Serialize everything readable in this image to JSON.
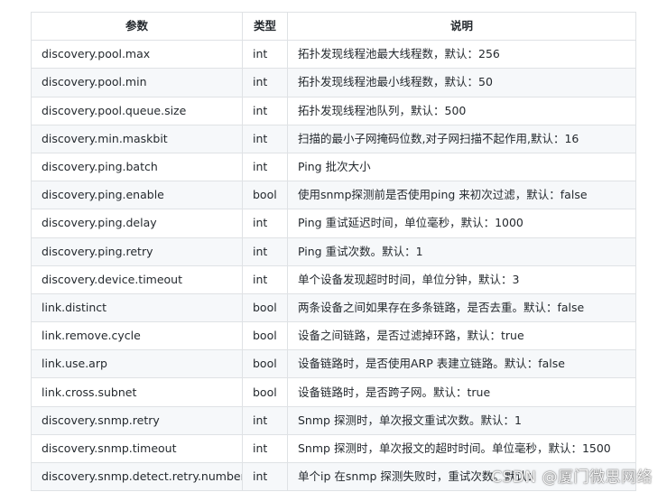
{
  "table": {
    "headers": [
      "参数",
      "类型",
      "说明"
    ],
    "rows": [
      [
        "discovery.pool.max",
        "int",
        "拓扑发现线程池最大线程数，默认：256"
      ],
      [
        "discovery.pool.min",
        "int",
        "拓扑发现线程池最小线程数，默认：50"
      ],
      [
        "discovery.pool.queue.size",
        "int",
        "拓扑发现线程池队列，默认：500"
      ],
      [
        "discovery.min.maskbit",
        "int",
        "扫描的最小子网掩码位数,对子网扫描不起作用,默认：16"
      ],
      [
        "discovery.ping.batch",
        "int",
        "Ping 批次大小"
      ],
      [
        "discovery.ping.enable",
        "bool",
        "使用snmp探测前是否使用ping 来初次过滤，默认：false"
      ],
      [
        "discovery.ping.delay",
        "int",
        "Ping 重试延迟时间，单位毫秒，默认：1000"
      ],
      [
        "discovery.ping.retry",
        "int",
        "Ping 重试次数。默认：1"
      ],
      [
        "discovery.device.timeout",
        "int",
        "单个设备发现超时时间，单位分钟，默认：3"
      ],
      [
        "link.distinct",
        "bool",
        "两条设备之间如果存在多条链路，是否去重。默认：false"
      ],
      [
        "link.remove.cycle",
        "bool",
        "设备之间链路，是否过滤掉环路，默认：true"
      ],
      [
        "link.use.arp",
        "bool",
        "设备链路时，是否使用ARP 表建立链路。默认：false"
      ],
      [
        "link.cross.subnet",
        "bool",
        "设备链路时，是否跨子网。默认：true"
      ],
      [
        "discovery.snmp.retry",
        "int",
        "Snmp 探测时，单次报文重试次数。默认：1"
      ],
      [
        "discovery.snmp.timeout",
        "int",
        "Snmp 探测时，单次报文的超时时间。单位毫秒，默认：1500"
      ],
      [
        "discovery.snmp.detect.retry.number",
        "int",
        "单个ip 在snmp 探测失败时，重试次数。默认："
      ]
    ]
  },
  "watermark": "CSDN @厦门微思网络"
}
